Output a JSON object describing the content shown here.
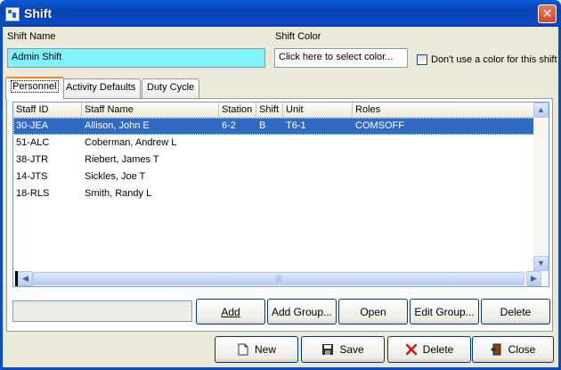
{
  "window": {
    "title": "Shift"
  },
  "form": {
    "shift_name_label": "Shift Name",
    "shift_name_value": "Admin Shift",
    "shift_color_label": "Shift Color",
    "shift_color_value": "Click here to select color...",
    "no_color_label": "Don't use a color for this shift",
    "no_color_checked": false
  },
  "tabs": [
    {
      "label": "Personnel",
      "active": true
    },
    {
      "label": "Activity Defaults",
      "active": false
    },
    {
      "label": "Duty Cycle",
      "active": false
    }
  ],
  "grid": {
    "columns": [
      "Staff ID",
      "Staff Name",
      "Station",
      "Shift",
      "Unit",
      "Roles"
    ],
    "rows": [
      {
        "staff_id": "30-JEA",
        "staff_name": "Allison, John E",
        "station": "6-2",
        "shift": "B",
        "unit": "T6-1",
        "roles": "COMSOFF",
        "selected": true
      },
      {
        "staff_id": "51-ALC",
        "staff_name": "Coberman, Andrew L",
        "station": "",
        "shift": "",
        "unit": "",
        "roles": "",
        "selected": false
      },
      {
        "staff_id": "38-JTR",
        "staff_name": "Riebert, James T",
        "station": "",
        "shift": "",
        "unit": "",
        "roles": "",
        "selected": false
      },
      {
        "staff_id": "14-JTS",
        "staff_name": "Sickles, Joe T",
        "station": "",
        "shift": "",
        "unit": "",
        "roles": "",
        "selected": false
      },
      {
        "staff_id": "18-RLS",
        "staff_name": "Smith, Randy L",
        "station": "",
        "shift": "",
        "unit": "",
        "roles": "",
        "selected": false
      }
    ]
  },
  "panel_buttons": {
    "add": "Add",
    "add_group": "Add Group...",
    "open": "Open",
    "edit_group": "Edit Group...",
    "delete": "Delete"
  },
  "footer_buttons": {
    "new": "New",
    "save": "Save",
    "delete": "Delete",
    "close": "Close"
  },
  "colors": {
    "title_bar": "#0a4cc4",
    "shift_name_bg": "#80f3f9",
    "selection": "#316ac5",
    "close_button": "#d2482a"
  },
  "icons": {
    "app": "app-window-icon",
    "close": "close-x-icon",
    "new": "new-document-icon",
    "save": "floppy-disk-icon",
    "delete": "red-x-icon",
    "close_door": "exit-door-icon"
  }
}
